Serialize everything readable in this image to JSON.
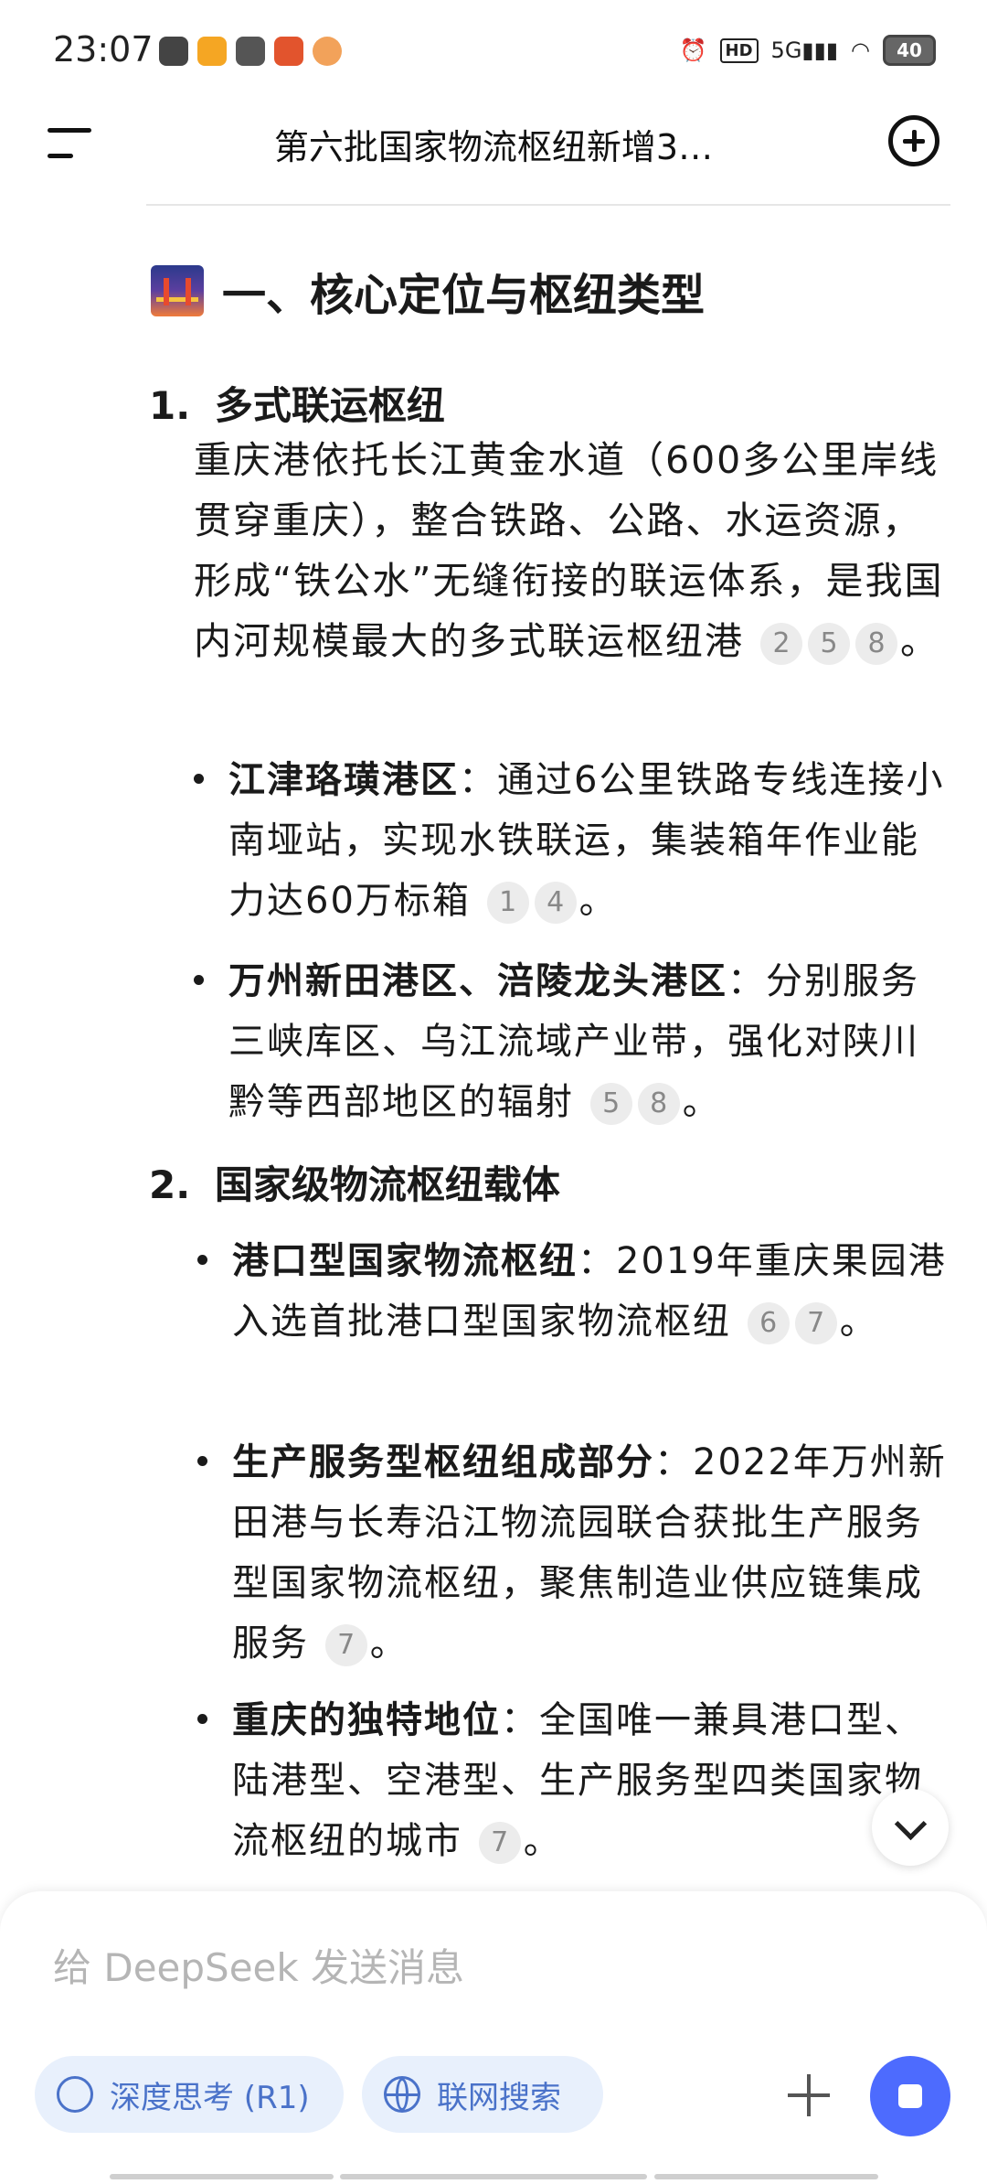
{
  "status": {
    "time": "23:07",
    "network": "5G",
    "battery": "40"
  },
  "header": {
    "title": "第六批国家物流枢纽新增3…"
  },
  "section": {
    "heading": "一、核心定位与枢纽类型"
  },
  "items": [
    {
      "num": "1.",
      "title": "多式联运枢纽",
      "desc": "重庆港依托长江黄金水道（600多公里岸线贯穿重庆），整合铁路、公路、水运资源，形成“铁公水”无缝衔接的联运体系，是我国内河规模最大的多式联运枢纽港",
      "desc_cites": [
        "2",
        "5",
        "8"
      ],
      "bullets": [
        {
          "label": "江津珞璜港区",
          "text": "：通过6公里铁路专线连接小南垭站，实现水铁联运，集装箱年作业能力达60万标箱",
          "cites": [
            "1",
            "4"
          ]
        },
        {
          "label": "万州新田港区、涪陵龙头港区",
          "text": "：分别服务三峡库区、乌江流域产业带，强化对陕川黔等西部地区的辐射",
          "cites": [
            "5",
            "8"
          ]
        }
      ]
    },
    {
      "num": "2.",
      "title": "国家级物流枢纽载体",
      "bullets": [
        {
          "label": "港口型国家物流枢纽",
          "text": "：2019年重庆果园港入选首批港口型国家物流枢纽",
          "cites": [
            "6",
            "7"
          ]
        },
        {
          "label": "生产服务型枢纽组成部分",
          "text": "：2022年万州新田港与长寿沿江物流园联合获批生产服务型国家物流枢纽，聚焦制造业供应链集成服务",
          "cites": [
            "7"
          ]
        },
        {
          "label": "重庆的独特地位",
          "text": "：全国唯一兼具港口型、陆港型、空港型、生产服务型四类国家物流枢纽的城市",
          "cites": [
            "7"
          ]
        }
      ]
    }
  ],
  "period": "。",
  "composer": {
    "placeholder": "给 DeepSeek 发送消息",
    "deep_think_label": "深度思考 (R1)",
    "search_label": "联网搜索"
  }
}
